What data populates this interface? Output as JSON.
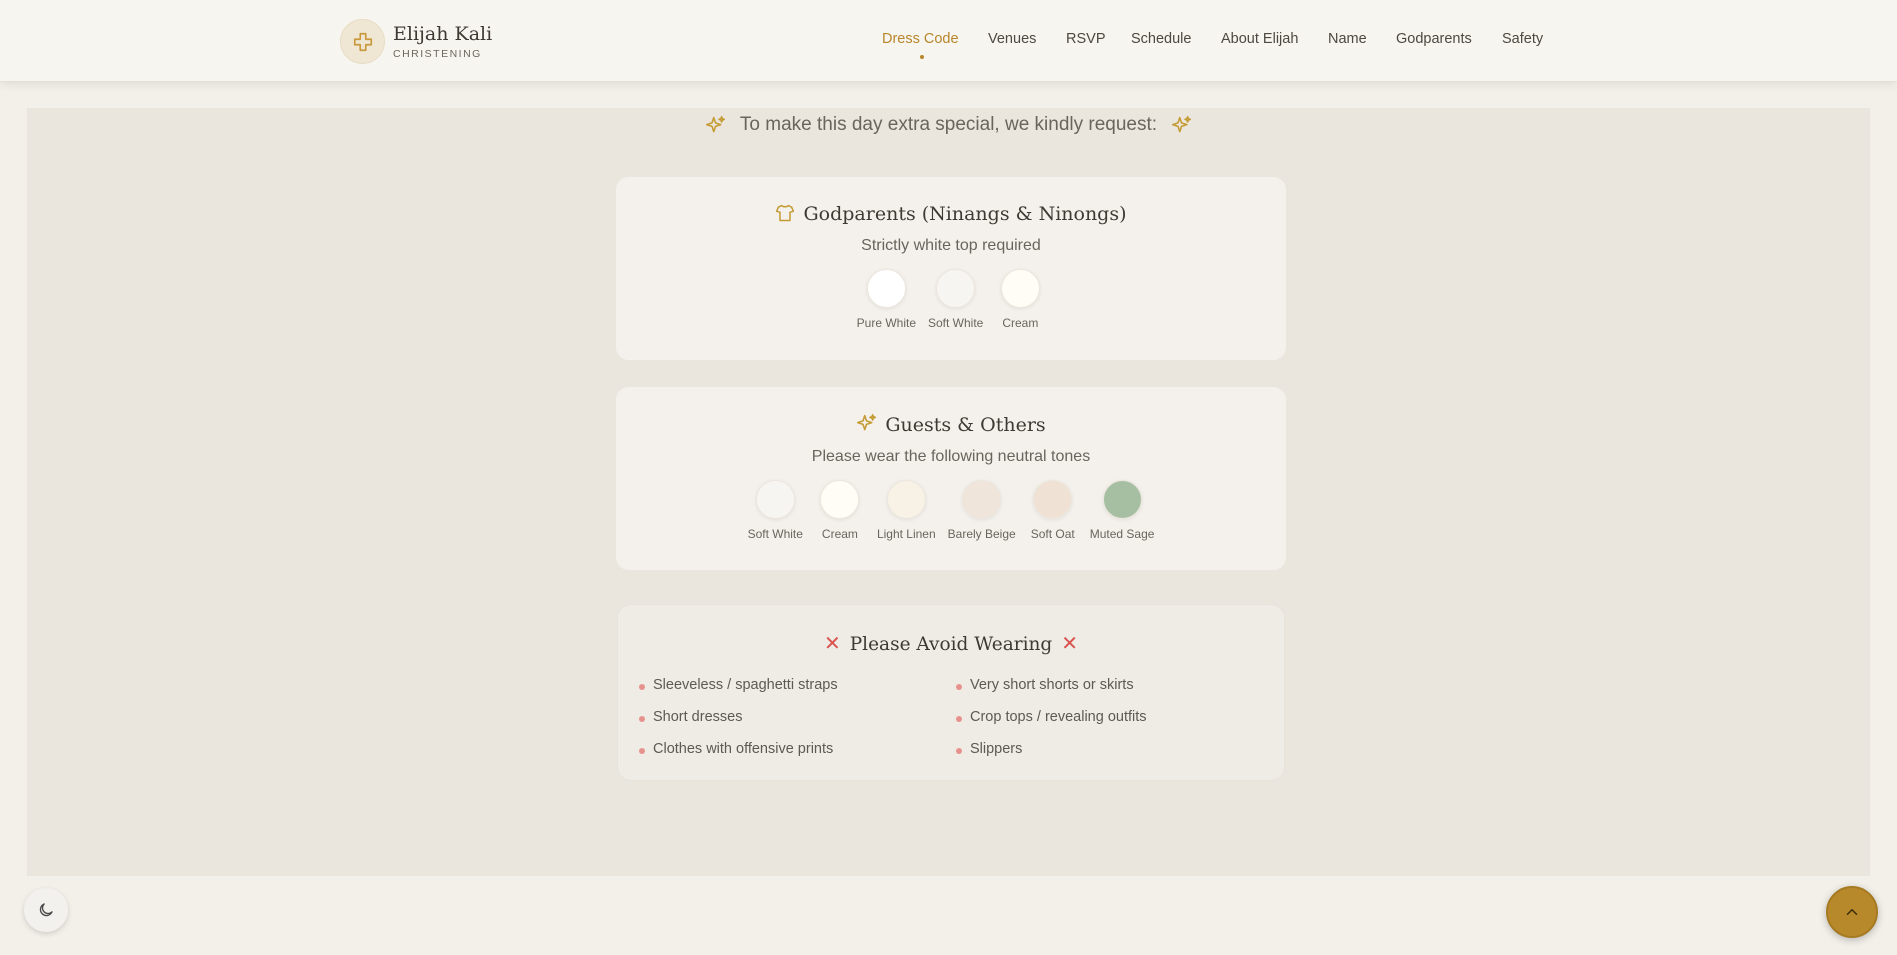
{
  "brand": {
    "name": "Elijah Kali",
    "subtitle": "CHRISTENING",
    "icon": "cross-icon"
  },
  "nav": {
    "items": [
      {
        "label": "Dress Code",
        "active": true
      },
      {
        "label": "Venues"
      },
      {
        "label": "RSVP"
      },
      {
        "label": "Schedule"
      },
      {
        "label": "About Elijah"
      },
      {
        "label": "Name"
      },
      {
        "label": "Godparents"
      },
      {
        "label": "Safety"
      }
    ]
  },
  "request": {
    "text": "To make this day extra special, we kindly request:",
    "icon": "sparkles-icon"
  },
  "godparents": {
    "title": "Godparents (Ninangs & Ninongs)",
    "icon": "shirt-icon",
    "subtitle": "Strictly white top required",
    "swatches": [
      {
        "label": "Pure White",
        "color": "#ffffff"
      },
      {
        "label": "Soft White",
        "color": "#f7f5f1"
      },
      {
        "label": "Cream",
        "color": "#fffdf6"
      }
    ]
  },
  "guests": {
    "title": "Guests & Others",
    "icon": "sparkles-icon",
    "subtitle": "Please wear the following neutral tones",
    "swatches": [
      {
        "label": "Soft White",
        "color": "#f7f5f1"
      },
      {
        "label": "Cream",
        "color": "#fffdf6"
      },
      {
        "label": "Light Linen",
        "color": "#f7f1e6"
      },
      {
        "label": "Barely Beige",
        "color": "#efe5db"
      },
      {
        "label": "Soft Oat",
        "color": "#efe2d4"
      },
      {
        "label": "Muted Sage",
        "color": "#a6bfa3"
      }
    ]
  },
  "avoid": {
    "title": "Please Avoid Wearing",
    "icon": "x-icon",
    "items_left": [
      "Sleeveless / spaghetti straps",
      "Short dresses",
      "Clothes with offensive prints"
    ],
    "items_right": [
      "Very short shorts or skirts",
      "Crop tops / revealing outfits",
      "Slippers"
    ]
  },
  "controls": {
    "theme_icon": "moon-icon",
    "top_icon": "chevron-up-icon"
  },
  "colors": {
    "accent": "#b8862a",
    "avoid_red": "#d9534f"
  }
}
